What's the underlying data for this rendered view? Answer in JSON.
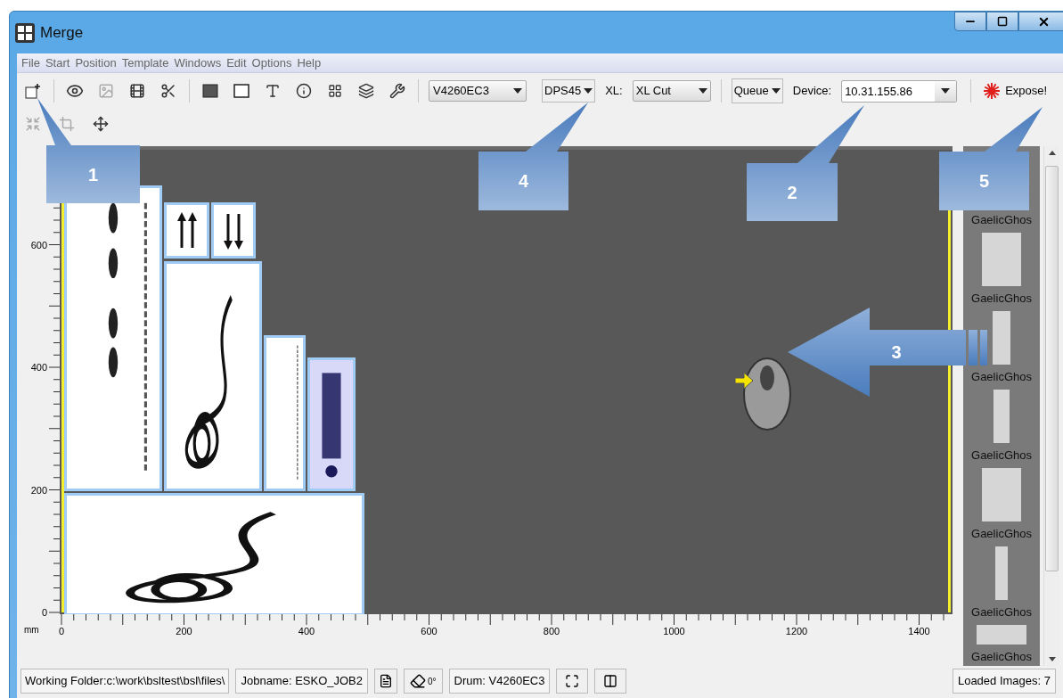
{
  "window": {
    "title": "Merge"
  },
  "menu": [
    "File",
    "Start",
    "Position",
    "Template",
    "Windows",
    "Edit",
    "Options",
    "Help"
  ],
  "toolbar": {
    "printer": "V4260EC3",
    "resolution": "DPS45",
    "xl_label": "XL:",
    "xl": "XL Cut",
    "queue": "Queue",
    "device_label": "Device:",
    "device": "10.31.155.86",
    "expose": "Expose!"
  },
  "ruler_y": {
    "unit": "mm",
    "labels": [
      "600",
      "400",
      "200",
      "0"
    ]
  },
  "ruler_x": {
    "labels": [
      "0",
      "200",
      "400",
      "600",
      "800",
      "1000",
      "1200",
      "1400"
    ]
  },
  "thumbnails": [
    {
      "label": "GaelicGhos"
    },
    {
      "label": "GaelicGhos"
    },
    {
      "label": "GaelicGhos"
    },
    {
      "label": "GaelicGhos"
    },
    {
      "label": "GaelicGhos"
    },
    {
      "label": "GaelicGhos"
    },
    {
      "label": "GaelicGhos"
    }
  ],
  "callouts": [
    {
      "kind": "box",
      "label": "1"
    },
    {
      "kind": "box",
      "label": "4"
    },
    {
      "kind": "box",
      "label": "5"
    },
    {
      "kind": "box",
      "label": "2"
    },
    {
      "kind": "arrow",
      "label": "3"
    }
  ],
  "status": {
    "folder": "Working Folder:c:\\work\\bsltest\\bsl\\files\\",
    "job": "Jobname: ESKO_JOB2",
    "rotation": "0°",
    "drum": "Drum: V4260EC3",
    "loaded": "Loaded Images: 7"
  }
}
